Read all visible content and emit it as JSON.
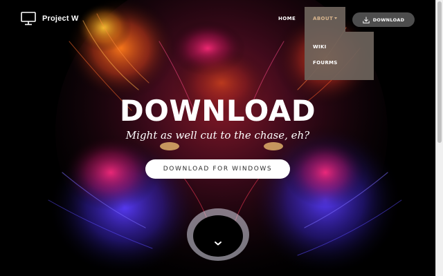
{
  "brand": {
    "name": "Project W",
    "icon": "monitor-icon"
  },
  "nav": {
    "home_label": "HOME",
    "about_label": "ABOUT",
    "about_dropdown": [
      "WIKI",
      "FOURMS"
    ],
    "download_label": "DOWNLOAD",
    "download_icon": "download-icon"
  },
  "hero": {
    "title": "DOWNLOAD",
    "subtitle": "Might as well cut to the chase, eh?",
    "cta_label": "DOWNLOAD FOR WINDOWS",
    "scroll_icon": "chevron-down-icon"
  },
  "colors": {
    "about_active_bg": "#6e645c",
    "about_active_text": "#d8b58d",
    "nav_download_bg": "#555555",
    "cta_bg": "#ffffff"
  }
}
